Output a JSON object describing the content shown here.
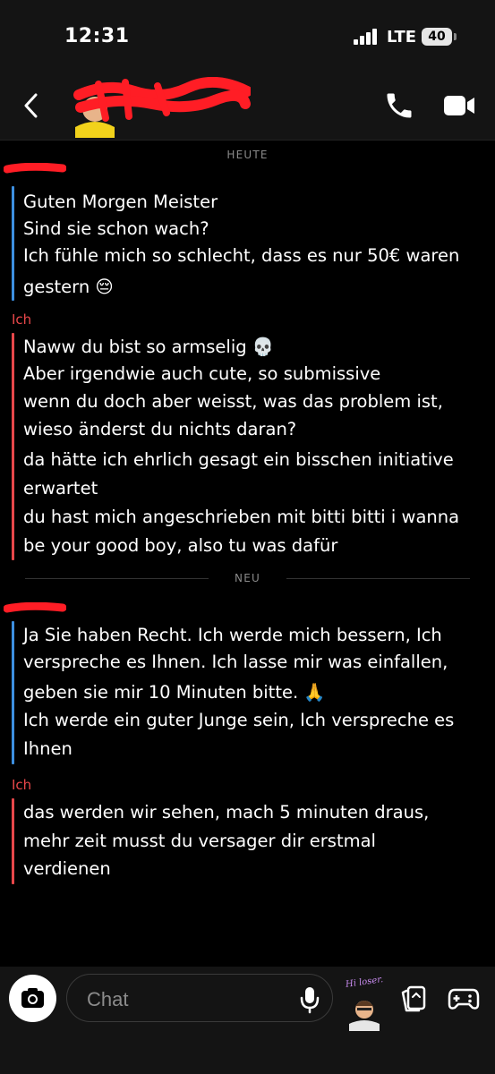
{
  "status_bar": {
    "time": "12:31",
    "carrier": "LTE",
    "battery": "40"
  },
  "header": {
    "back_icon": "chevron-left-icon",
    "call_icon": "phone-icon",
    "video_icon": "video-camera-icon",
    "redaction_color": "#ff1d25"
  },
  "chat": {
    "date_divider": "HEUTE",
    "new_divider": "NEU",
    "sender_me": "Ich",
    "colors": {
      "other_bar": "#3d8fe0",
      "me_bar": "#e8474a"
    },
    "groups": [
      {
        "sender": "other",
        "lines": [
          "Guten Morgen Meister",
          "Sind sie schon wach?",
          "Ich fühle mich so schlecht, dass es nur 50€ waren",
          "gestern 😔"
        ]
      },
      {
        "sender": "me",
        "lines": [
          "Naww du bist so armselig 💀",
          "Aber irgendwie auch cute, so submissive",
          "wenn du doch aber weisst, was das problem ist,",
          "wieso änderst du nichts daran?",
          "da hätte ich ehrlich gesagt ein bisschen initiative",
          "erwartet",
          "du hast mich angeschrieben mit bitti bitti i wanna",
          "be your good boy, also tu was dafür"
        ]
      },
      {
        "sender": "other",
        "lines": [
          "Ja Sie haben Recht. Ich werde mich bessern, Ich",
          "verspreche es Ihnen. Ich lasse mir was einfallen,",
          "geben sie mir 10 Minuten bitte. 🙏",
          "Ich werde ein guter Junge sein, Ich verspreche es",
          "Ihnen"
        ]
      },
      {
        "sender": "me",
        "lines": [
          "das werden wir sehen, mach 5 minuten draus,",
          "mehr zeit musst du versager dir erstmal",
          "verdienen"
        ]
      }
    ]
  },
  "composer": {
    "placeholder": "Chat",
    "camera_icon": "camera-icon",
    "mic_icon": "microphone-icon",
    "bitmoji_caption": "Hi loser.",
    "cards_icon": "cards-icon",
    "games_icon": "game-controller-icon"
  }
}
